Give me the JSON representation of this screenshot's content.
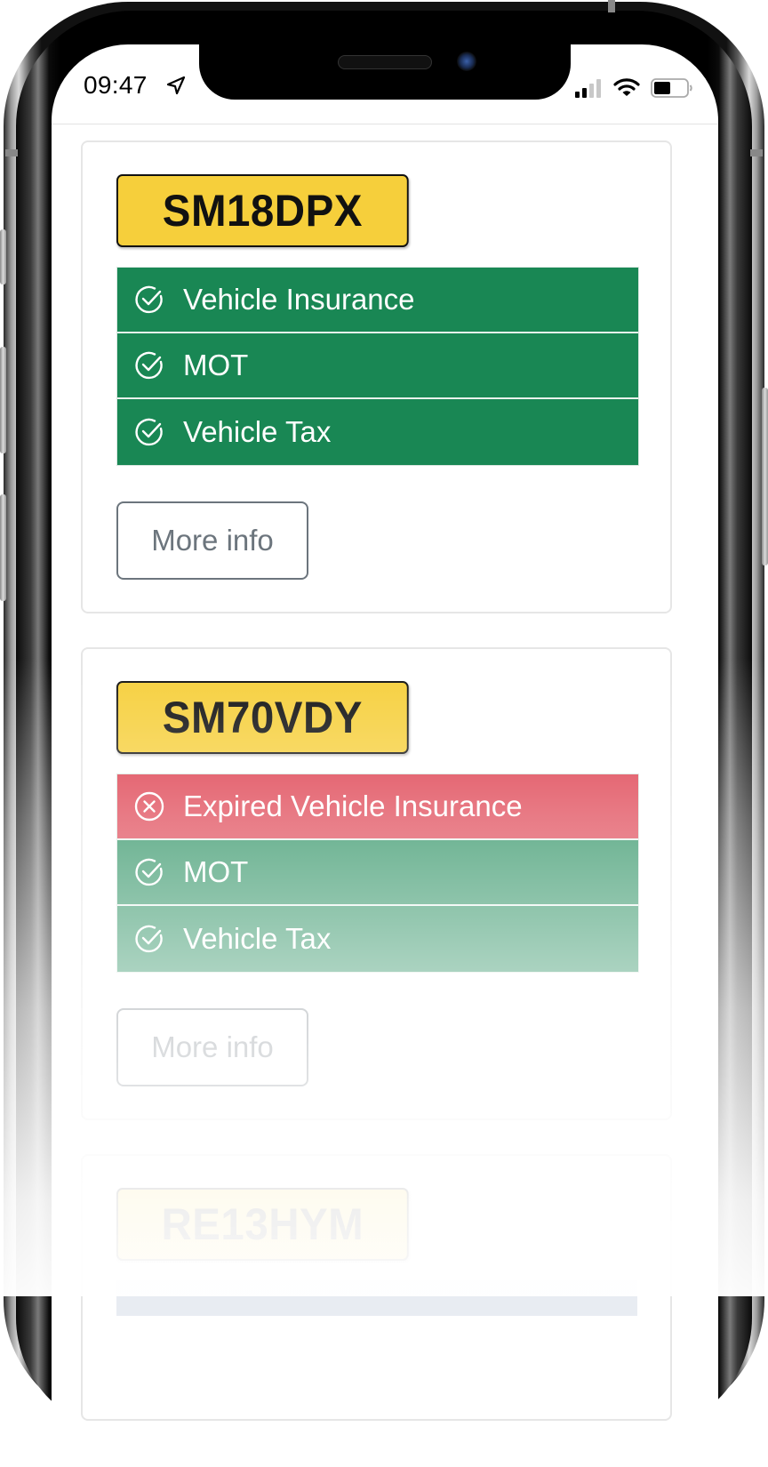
{
  "status_bar": {
    "time": "09:47",
    "location_icon": "location-arrow-icon",
    "signal_icon": "cellular-signal-icon",
    "wifi_icon": "wifi-icon",
    "battery_icon": "battery-icon",
    "signal_bars_active": 2,
    "signal_bars_total": 4
  },
  "colors": {
    "plate_yellow": "#f6cf3b",
    "ok_green": "#198754",
    "expired_red": "#dc3545",
    "button_gray": "#6c757d"
  },
  "vehicles": [
    {
      "registration": "SM18DPX",
      "checks": [
        {
          "label": "Vehicle Insurance",
          "status": "ok",
          "icon": "check-circle-icon"
        },
        {
          "label": "MOT",
          "status": "ok",
          "icon": "check-circle-icon"
        },
        {
          "label": "Vehicle Tax",
          "status": "ok",
          "icon": "check-circle-icon"
        }
      ],
      "more_info_label": "More info"
    },
    {
      "registration": "SM70VDY",
      "checks": [
        {
          "label": "Expired Vehicle Insurance",
          "status": "expired",
          "icon": "x-circle-icon"
        },
        {
          "label": "MOT",
          "status": "ok",
          "icon": "check-circle-icon"
        },
        {
          "label": "Vehicle Tax",
          "status": "ok",
          "icon": "check-circle-icon"
        }
      ],
      "more_info_label": "More info"
    },
    {
      "registration": "RE13HYM",
      "checks": [],
      "more_info_label": ""
    }
  ]
}
